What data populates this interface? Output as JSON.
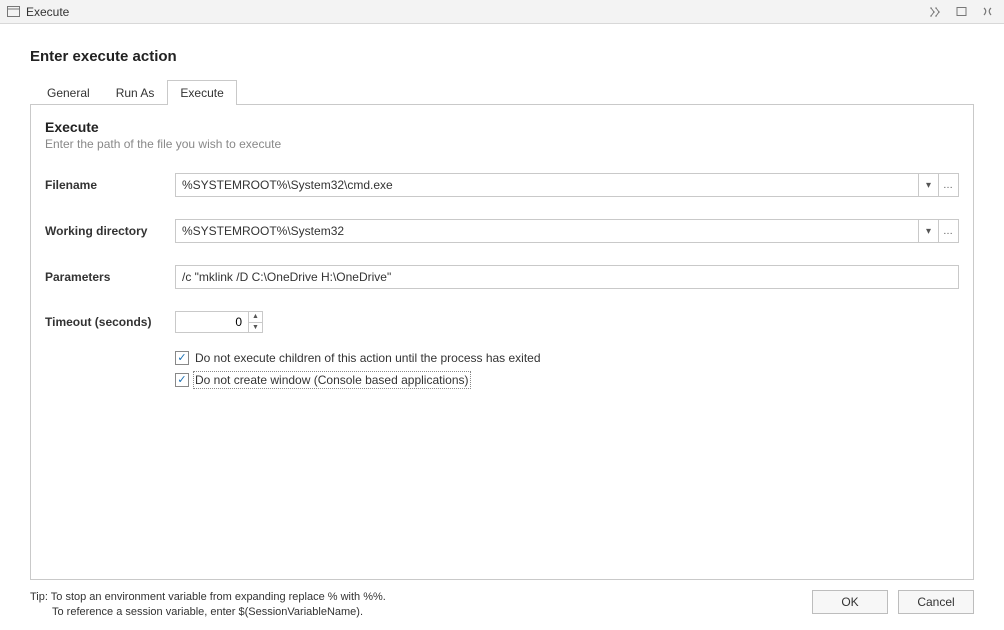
{
  "window": {
    "title": "Execute"
  },
  "page_title": "Enter execute action",
  "tabs": {
    "general": "General",
    "runas": "Run As",
    "execute": "Execute"
  },
  "section": {
    "title": "Execute",
    "subtitle": "Enter the path of the file you wish to execute"
  },
  "fields": {
    "filename_label": "Filename",
    "filename_value": "%SYSTEMROOT%\\System32\\cmd.exe",
    "workingdir_label": "Working directory",
    "workingdir_value": "%SYSTEMROOT%\\System32",
    "parameters_label": "Parameters",
    "parameters_value": "/c \"mklink /D C:\\OneDrive H:\\OneDrive\"",
    "timeout_label": "Timeout (seconds)",
    "timeout_value": "0"
  },
  "checks": {
    "wait_children_label": "Do not execute children of this action until the process has exited",
    "no_window_label": "Do not create window (Console based applications)"
  },
  "tip": {
    "line1": "Tip: To stop an environment variable from expanding replace % with %%.",
    "line2": "To reference a session variable, enter $(SessionVariableName)."
  },
  "buttons": {
    "ok": "OK",
    "cancel": "Cancel"
  },
  "glyphs": {
    "dropdown": "▾",
    "ellipsis": "…",
    "spin_up": "▲",
    "spin_down": "▼",
    "check": "✓"
  }
}
